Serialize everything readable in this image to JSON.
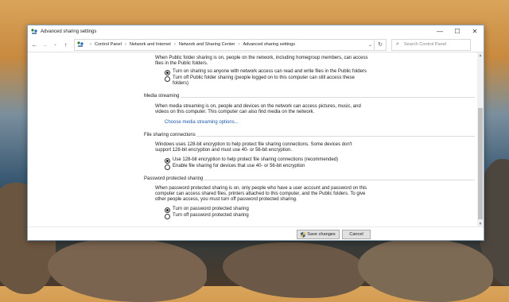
{
  "window": {
    "title": "Advanced sharing settings",
    "controls": {
      "minimize": "—",
      "maximize": "☐",
      "close": "✕"
    }
  },
  "address": {
    "crumbs": [
      "Control Panel",
      "Network and Internet",
      "Network and Sharing Center",
      "Advanced sharing settings"
    ],
    "search_placeholder": "Search Control Panel"
  },
  "public_folder": {
    "description": "When Public folder sharing is on, people on the network, including homegroup members, can access files in the Public folders.",
    "options": [
      {
        "label": "Turn on sharing so anyone with network access can read and write files in the Public folders",
        "selected": true
      },
      {
        "label": "Turn off Public folder sharing (people logged on to this computer can still access these folders)",
        "selected": false
      }
    ]
  },
  "media_streaming": {
    "heading": "Media streaming",
    "description": "When media streaming is on, people and devices on the network can access pictures, music, and videos on this computer. This computer can also find media on the network.",
    "link": "Choose media streaming options..."
  },
  "file_sharing": {
    "heading": "File sharing connections",
    "description": "Windows uses 128-bit encryption to help protect file sharing connections. Some devices don't support 128-bit encryption and must use 40- or 56-bit encryption.",
    "options": [
      {
        "label": "Use 128-bit encryption to help protect file sharing connections (recommended)",
        "selected": true
      },
      {
        "label": "Enable file sharing for devices that use 40- or 56-bit encryption",
        "selected": false
      }
    ]
  },
  "password_sharing": {
    "heading": "Password protected sharing",
    "description": "When password protected sharing is on, only people who have a user account and password on this computer can access shared files, printers attached to this computer, and the Public folders. To give other people access, you must turn off password protected sharing.",
    "options": [
      {
        "label": "Turn on password protected sharing",
        "selected": true
      },
      {
        "label": "Turn off password protected sharing",
        "selected": false
      }
    ]
  },
  "footer": {
    "save_label": "Save changes",
    "cancel_label": "Cancel"
  }
}
